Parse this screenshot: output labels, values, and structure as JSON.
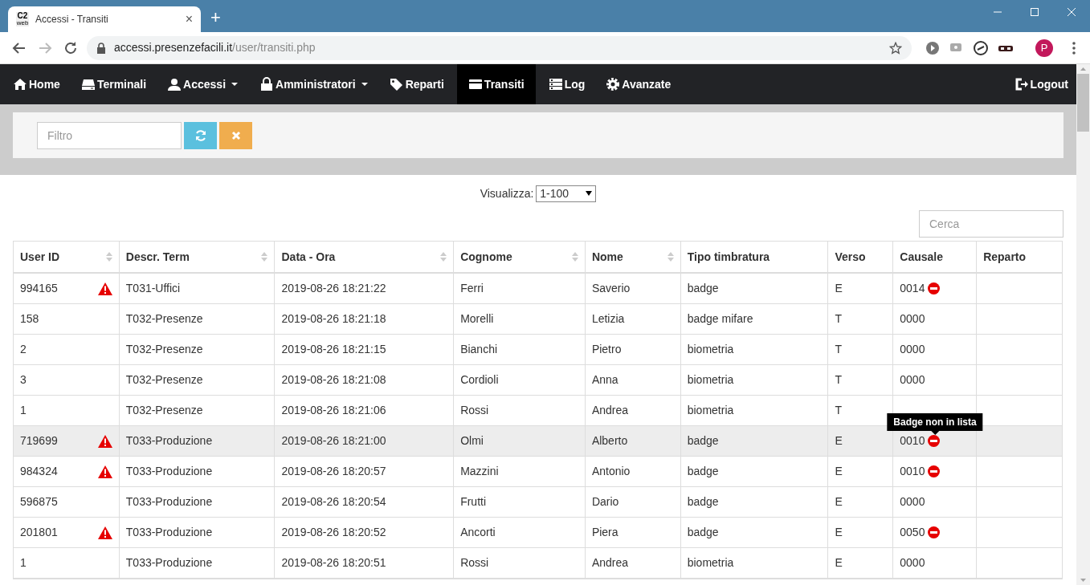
{
  "browser": {
    "tab": {
      "favicon": [
        "C2",
        "web"
      ],
      "title": "Accessi - Transiti",
      "close": "×"
    },
    "new_tab": "+",
    "url": {
      "host": "accessi.presenzefacili.it",
      "path": "/user/transiti.php"
    },
    "avatar": "P"
  },
  "navbar": {
    "items": [
      {
        "label": "Home",
        "kind": "home",
        "dropdown": false,
        "selected": false
      },
      {
        "label": "Terminali",
        "kind": "drive",
        "dropdown": false,
        "selected": false
      },
      {
        "label": "Accessi",
        "kind": "user",
        "dropdown": true,
        "selected": false
      },
      {
        "label": "Amministratori",
        "kind": "lock",
        "dropdown": true,
        "selected": false
      },
      {
        "label": "Reparti",
        "kind": "tags",
        "dropdown": false,
        "selected": false
      },
      {
        "label": "Transiti",
        "kind": "card",
        "dropdown": false,
        "selected": true
      },
      {
        "label": "Log",
        "kind": "list",
        "dropdown": false,
        "selected": false
      },
      {
        "label": "Avanzate",
        "kind": "gear",
        "dropdown": false,
        "selected": false
      }
    ],
    "logout": "Logout"
  },
  "filter": {
    "placeholder": "Filtro"
  },
  "display": {
    "label": "Visualizza:",
    "value": "1-100"
  },
  "search": {
    "placeholder": "Cerca"
  },
  "table": {
    "columns": [
      {
        "label": "User ID",
        "sortable": true
      },
      {
        "label": "Descr. Term",
        "sortable": true
      },
      {
        "label": "Data - Ora",
        "sortable": true
      },
      {
        "label": "Cognome",
        "sortable": true
      },
      {
        "label": "Nome",
        "sortable": true
      },
      {
        "label": "Tipo timbratura",
        "sortable": false
      },
      {
        "label": "Verso",
        "sortable": false
      },
      {
        "label": "Causale",
        "sortable": false
      },
      {
        "label": "Reparto",
        "sortable": false
      }
    ],
    "rows": [
      {
        "cells": [
          "994165",
          "T031-Uffici",
          "2019-08-26 18:21:22",
          "Ferri",
          "Saverio",
          "badge",
          "E",
          "0014",
          ""
        ],
        "warning": true,
        "blocked": true,
        "hovered": false
      },
      {
        "cells": [
          "158",
          "T032-Presenze",
          "2019-08-26 18:21:18",
          "Morelli",
          "Letizia",
          "badge mifare",
          "T",
          "0000",
          ""
        ],
        "warning": false,
        "blocked": false,
        "hovered": false
      },
      {
        "cells": [
          "2",
          "T032-Presenze",
          "2019-08-26 18:21:15",
          "Bianchi",
          "Pietro",
          "biometria",
          "T",
          "0000",
          ""
        ],
        "warning": false,
        "blocked": false,
        "hovered": false
      },
      {
        "cells": [
          "3",
          "T032-Presenze",
          "2019-08-26 18:21:08",
          "Cordioli",
          "Anna",
          "biometria",
          "T",
          "0000",
          ""
        ],
        "warning": false,
        "blocked": false,
        "hovered": false
      },
      {
        "cells": [
          "1",
          "T032-Presenze",
          "2019-08-26 18:21:06",
          "Rossi",
          "Andrea",
          "biometria",
          "T",
          "",
          ""
        ],
        "warning": false,
        "blocked": false,
        "hovered": false
      },
      {
        "cells": [
          "719699",
          "T033-Produzione",
          "2019-08-26 18:21:00",
          "Olmi",
          "Alberto",
          "badge",
          "E",
          "0010",
          ""
        ],
        "warning": true,
        "blocked": true,
        "hovered": true,
        "tooltip": "Badge non in lista"
      },
      {
        "cells": [
          "984324",
          "T033-Produzione",
          "2019-08-26 18:20:57",
          "Mazzini",
          "Antonio",
          "badge",
          "E",
          "0010",
          ""
        ],
        "warning": true,
        "blocked": true,
        "hovered": false
      },
      {
        "cells": [
          "596875",
          "T033-Produzione",
          "2019-08-26 18:20:54",
          "Frutti",
          "Dario",
          "badge",
          "E",
          "0000",
          ""
        ],
        "warning": false,
        "blocked": false,
        "hovered": false
      },
      {
        "cells": [
          "201801",
          "T033-Produzione",
          "2019-08-26 18:20:52",
          "Ancorti",
          "Piera",
          "badge",
          "E",
          "0050",
          ""
        ],
        "warning": true,
        "blocked": true,
        "hovered": false
      },
      {
        "cells": [
          "1",
          "T033-Produzione",
          "2019-08-26 18:20:51",
          "Rossi",
          "Andrea",
          "biometria",
          "E",
          "0000",
          ""
        ],
        "warning": false,
        "blocked": false,
        "hovered": false
      }
    ]
  }
}
